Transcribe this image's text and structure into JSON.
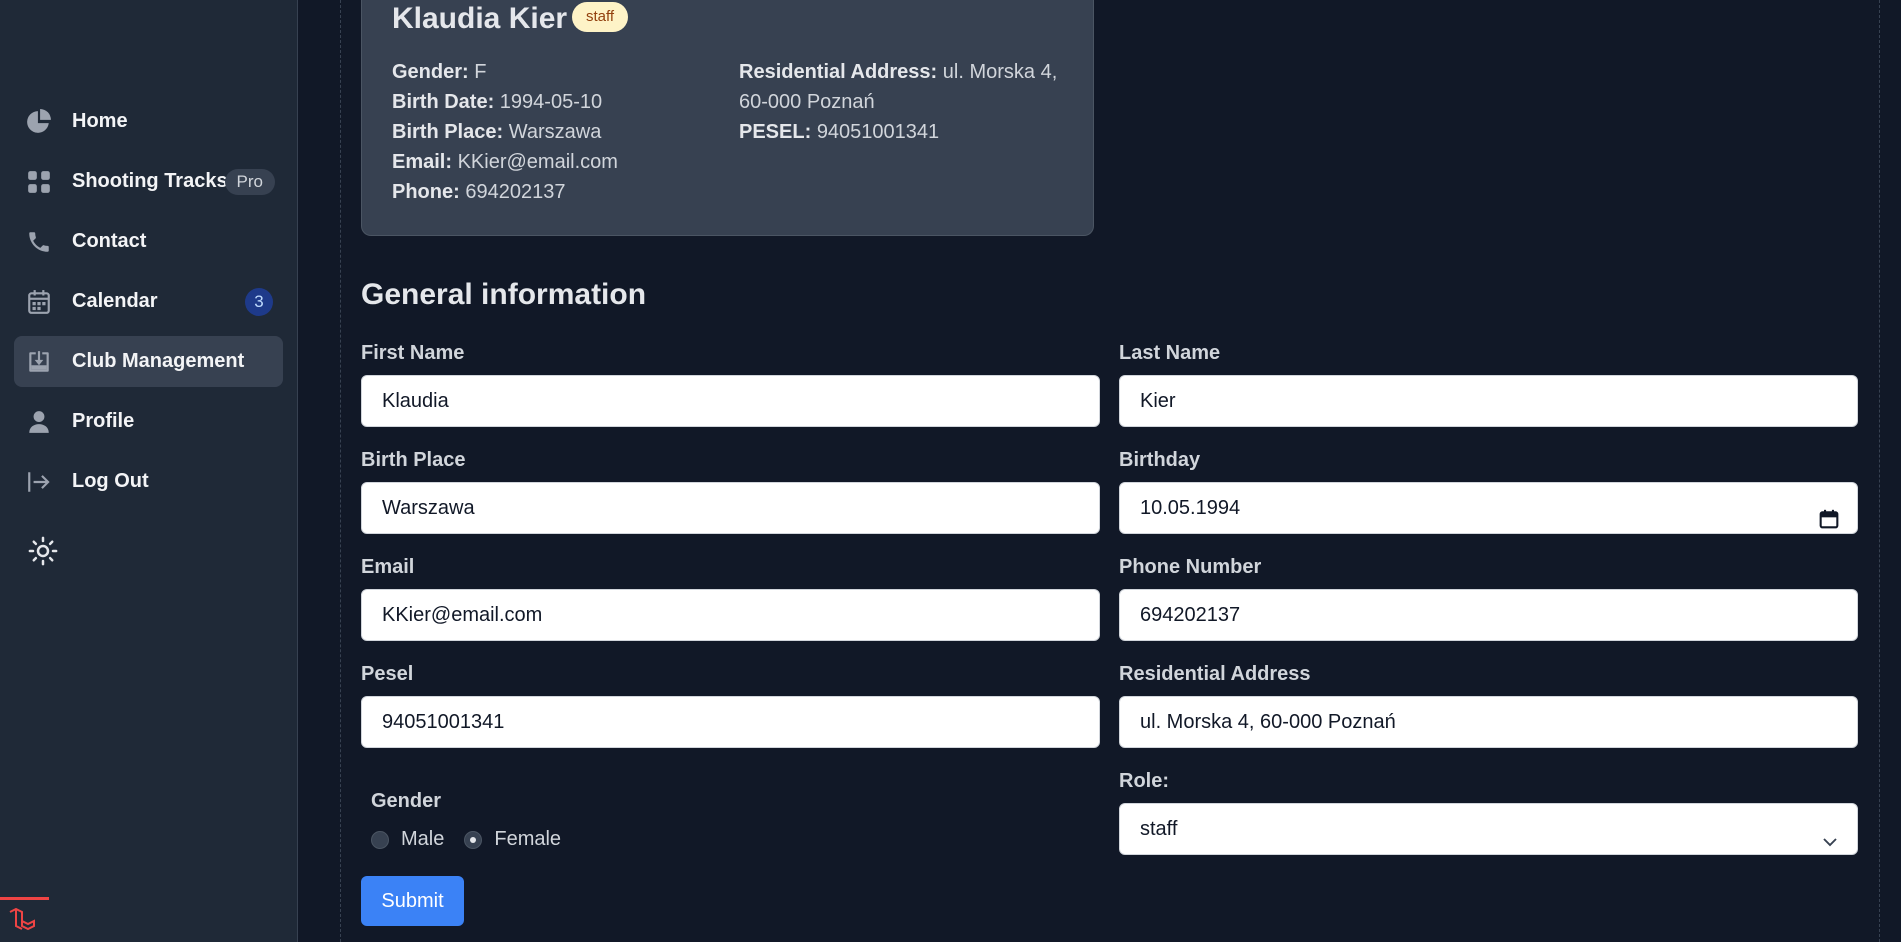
{
  "sidebar": {
    "items": [
      {
        "label": "Home",
        "icon": "pie-chart-icon"
      },
      {
        "label": "Shooting Tracks",
        "icon": "grid-icon",
        "badge": "Pro"
      },
      {
        "label": "Contact",
        "icon": "phone-icon"
      },
      {
        "label": "Calendar",
        "icon": "calendar-icon",
        "count": "3"
      },
      {
        "label": "Club Management",
        "icon": "inbox-download-icon",
        "active": true
      },
      {
        "label": "Profile",
        "icon": "user-icon"
      },
      {
        "label": "Log Out",
        "icon": "logout-icon"
      }
    ],
    "theme_toggle_icon": "sun-icon"
  },
  "card": {
    "name": "Klaudia Kier",
    "role_badge": "staff",
    "gender_label": "Gender:",
    "gender": "F",
    "birth_date_label": "Birth Date:",
    "birth_date": "1994-05-10",
    "birth_place_label": "Birth Place:",
    "birth_place": "Warszawa",
    "email_label": "Email:",
    "email": "KKier@email.com",
    "phone_label": "Phone:",
    "phone": "694202137",
    "address_label": "Residential Address:",
    "address_line1": "ul. Morska 4,",
    "address_line2": "60-000 Poznań",
    "pesel_label": "PESEL:",
    "pesel": "94051001341"
  },
  "form": {
    "title": "General information",
    "first_name_label": "First Name",
    "first_name": "Klaudia",
    "last_name_label": "Last Name",
    "last_name": "Kier",
    "birth_place_label": "Birth Place",
    "birth_place": "Warszawa",
    "birthday_label": "Birthday",
    "birthday": "10.05.1994",
    "email_label": "Email",
    "email": "KKier@email.com",
    "phone_label": "Phone Number",
    "phone": "694202137",
    "pesel_label": "Pesel",
    "pesel": "94051001341",
    "address_label": "Residential Address",
    "address": "ul. Morska 4, 60-000 Poznań",
    "gender_label": "Gender",
    "gender_options": [
      "Male",
      "Female"
    ],
    "gender_selected": "Female",
    "role_label": "Role:",
    "role": "staff",
    "submit_label": "Submit"
  },
  "colors": {
    "background": "#111827",
    "sidebar": "#1f2937",
    "card": "#374151",
    "primary_button": "#3b82f6",
    "badge": "#fef3c7",
    "laravel_red": "#ef4444"
  }
}
